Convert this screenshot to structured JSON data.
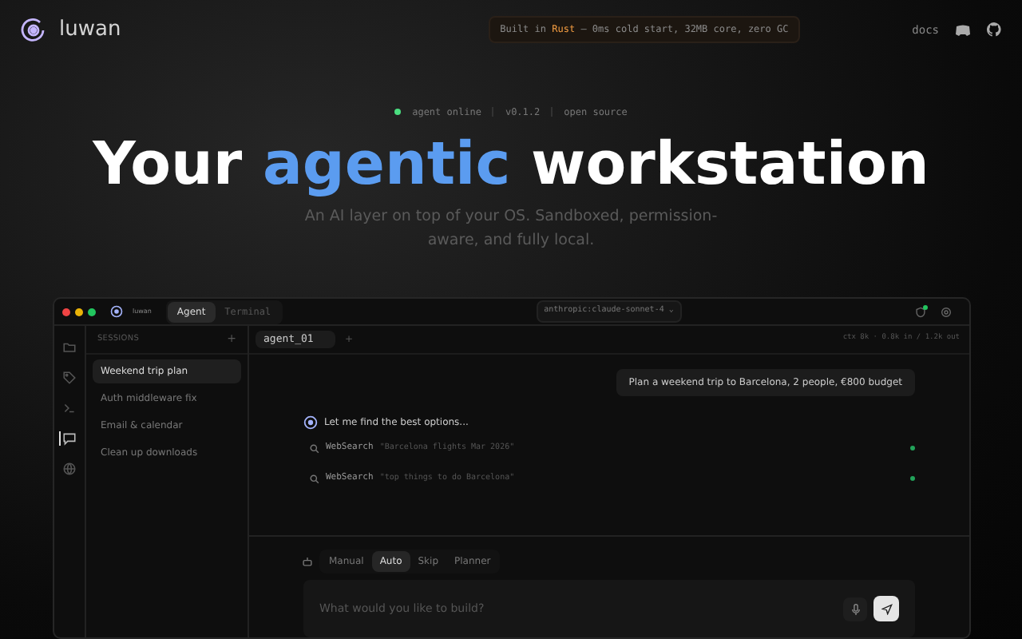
{
  "header": {
    "logo_text": "luwan",
    "banner": {
      "prefix": "Built in ",
      "highlight": "Rust",
      "suffix": " — 0ms cold start, 32MB core, zero GC"
    },
    "links": [
      {
        "label": "docs"
      }
    ]
  },
  "status": {
    "online": true,
    "items": [
      "agent online",
      "v0.1.2",
      "open source"
    ]
  },
  "hero": {
    "title_before": "Your ",
    "title_accent": "agentic",
    "title_after": " workstation",
    "subtitle": "An AI layer on top of your OS. Sandboxed, permission-aware, and fully local."
  },
  "app": {
    "brand": "luwan",
    "tabs": [
      {
        "label": "Agent",
        "selected": true
      },
      {
        "label": "Terminal",
        "selected": false
      }
    ],
    "model": "anthropic:claude-sonnet-4 ⌄",
    "rail": [
      {
        "kind": "folder",
        "selected": false
      },
      {
        "kind": "tag",
        "selected": false
      },
      {
        "kind": "terminal",
        "selected": false
      },
      {
        "kind": "chat",
        "selected": true
      },
      {
        "kind": "globe",
        "selected": false
      }
    ],
    "sessions": {
      "title": "SESSIONS",
      "add": "+",
      "items": [
        {
          "label": "Weekend trip plan",
          "selected": true
        },
        {
          "label": "Auth middleware fix",
          "selected": false
        },
        {
          "label": "Email & calendar",
          "selected": false
        },
        {
          "label": "Clean up downloads",
          "selected": false
        }
      ]
    },
    "agent_tab": "agent_01",
    "add_tab": "+",
    "tokens": "ctx 8k · 0.8k in / 1.2k out",
    "user_message": "Plan a weekend trip to Barcelona, 2 people, €800 budget",
    "agent_message": "Let me find the best options...",
    "tool_calls": [
      {
        "tool": "WebSearch",
        "query": "\"Barcelona flights Mar 2026\"",
        "done": true
      },
      {
        "tool": "WebSearch",
        "query": "\"top things to do Barcelona\"",
        "done": true
      }
    ],
    "modes": [
      {
        "label": "Manual",
        "selected": false
      },
      {
        "label": "Auto",
        "selected": true
      },
      {
        "label": "Skip",
        "selected": false
      },
      {
        "label": "Planner",
        "selected": false
      }
    ],
    "input": {
      "placeholder": "What would you like to build?"
    }
  }
}
